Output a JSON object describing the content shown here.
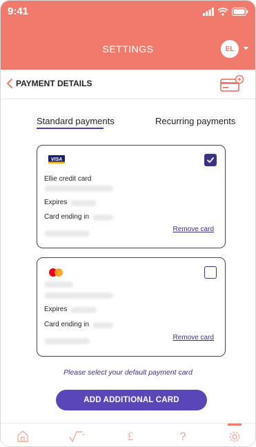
{
  "status_bar": {
    "time": "9:41"
  },
  "header": {
    "title": "SETTINGS",
    "avatar_initials": "EL"
  },
  "subheader": {
    "title": "PAYMENT DETAILS"
  },
  "tabs": [
    {
      "label": "Standard payments",
      "active": true
    },
    {
      "label": "Recurring payments",
      "active": false
    }
  ],
  "cards": [
    {
      "brand": "VISA",
      "name": "Ellie credit card",
      "expires_label": "Expires",
      "ending_label": "Card ending in",
      "selected": true,
      "remove_label": "Remove card"
    },
    {
      "brand": "mastercard",
      "expires_label": "Expires",
      "ending_label": "Card ending in",
      "selected": false,
      "remove_label": "Remove card"
    }
  ],
  "instruction": "Please select your default payment card",
  "add_button_label": "ADD ADDITIONAL CARD",
  "tabbar": {
    "items": [
      "home-icon",
      "chart-icon",
      "pound-icon",
      "help-icon",
      "settings-icon"
    ],
    "active_index": 4
  },
  "colors": {
    "brand_coral": "#f07a6b",
    "accent_purple": "#3b3285",
    "button_purple": "#5a45b9"
  }
}
